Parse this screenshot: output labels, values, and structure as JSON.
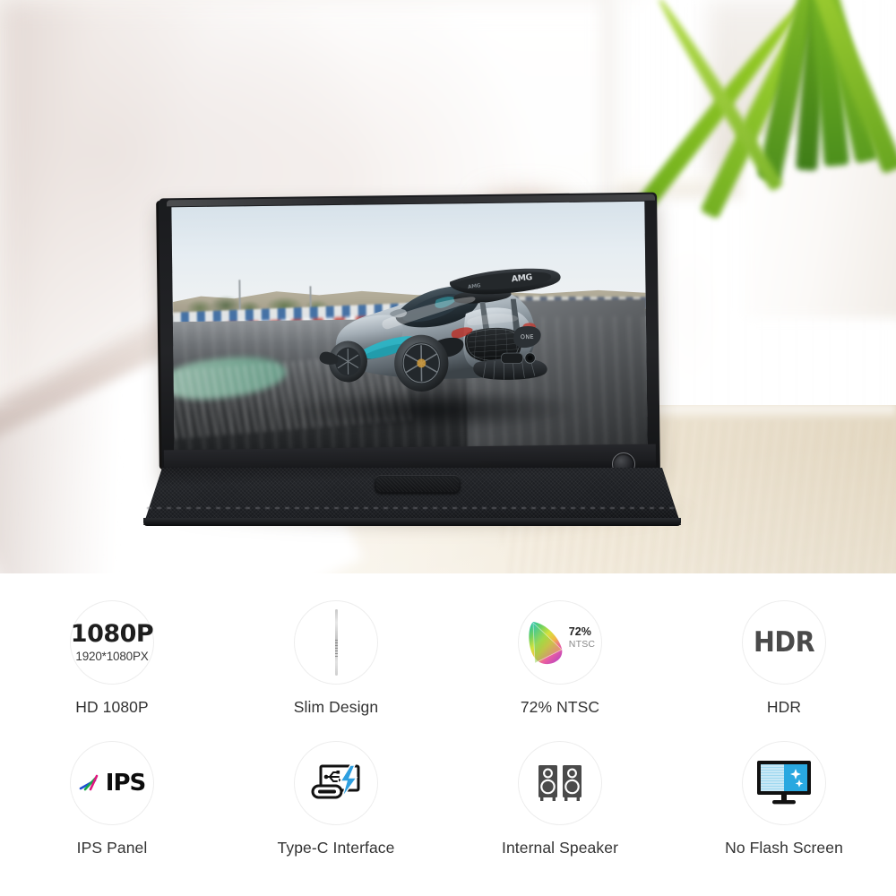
{
  "hero": {
    "product": "portable-monitor",
    "scene": {
      "background": "blurred bright white interior with shelf",
      "plant": "green blade-leaf plant in white rectangular pot",
      "surface": "light wooden desk"
    },
    "device": {
      "type": "portable monitor with folio stand",
      "bezel_color": "#1c1d20",
      "power_button": "circular power button on bottom-right bezel",
      "screen_content": "silver Mercedes-AMG Project One supercar, rear three-quarter view on a racetrack",
      "wing_text": "AMG",
      "rear_badge": "ONE",
      "accent_color": "#29b6c8"
    }
  },
  "features": {
    "row1": [
      {
        "id": "hd-1080p",
        "label": "HD 1080P",
        "icon": "resolution-1080p-icon",
        "badge_main": "1080P",
        "badge_sub": "1920*1080PX"
      },
      {
        "id": "slim-design",
        "label": "Slim Design",
        "icon": "slim-profile-icon"
      },
      {
        "id": "ntsc-72",
        "label": "72% NTSC",
        "icon": "color-gamut-icon",
        "badge_main": "72%",
        "badge_sub": "NTSC"
      },
      {
        "id": "hdr",
        "label": "HDR",
        "icon": "hdr-icon",
        "badge_main": "HDR"
      }
    ],
    "row2": [
      {
        "id": "ips-panel",
        "label": "IPS Panel",
        "icon": "ips-icon",
        "badge_main": "IPS"
      },
      {
        "id": "type-c-interface",
        "label": "Type-C Interface",
        "icon": "usb-type-c-icon"
      },
      {
        "id": "internal-speaker",
        "label": "Internal Speaker",
        "icon": "speakers-icon"
      },
      {
        "id": "no-flash-screen",
        "label": "No Flash Screen",
        "icon": "flicker-free-monitor-icon"
      }
    ]
  },
  "colors": {
    "circle_border": "#ededed",
    "label_text": "#333333",
    "hdr_text": "#4a4a4a",
    "accent_blue": "#1f9fd8",
    "ips_blue": "#1b4fd0",
    "ips_green": "#17a84a",
    "ips_magenta": "#e0157f",
    "speaker_gray": "#4a4a4a",
    "screen_blue": "#29a8e0",
    "screen_light_blue": "#9fd8f0"
  }
}
